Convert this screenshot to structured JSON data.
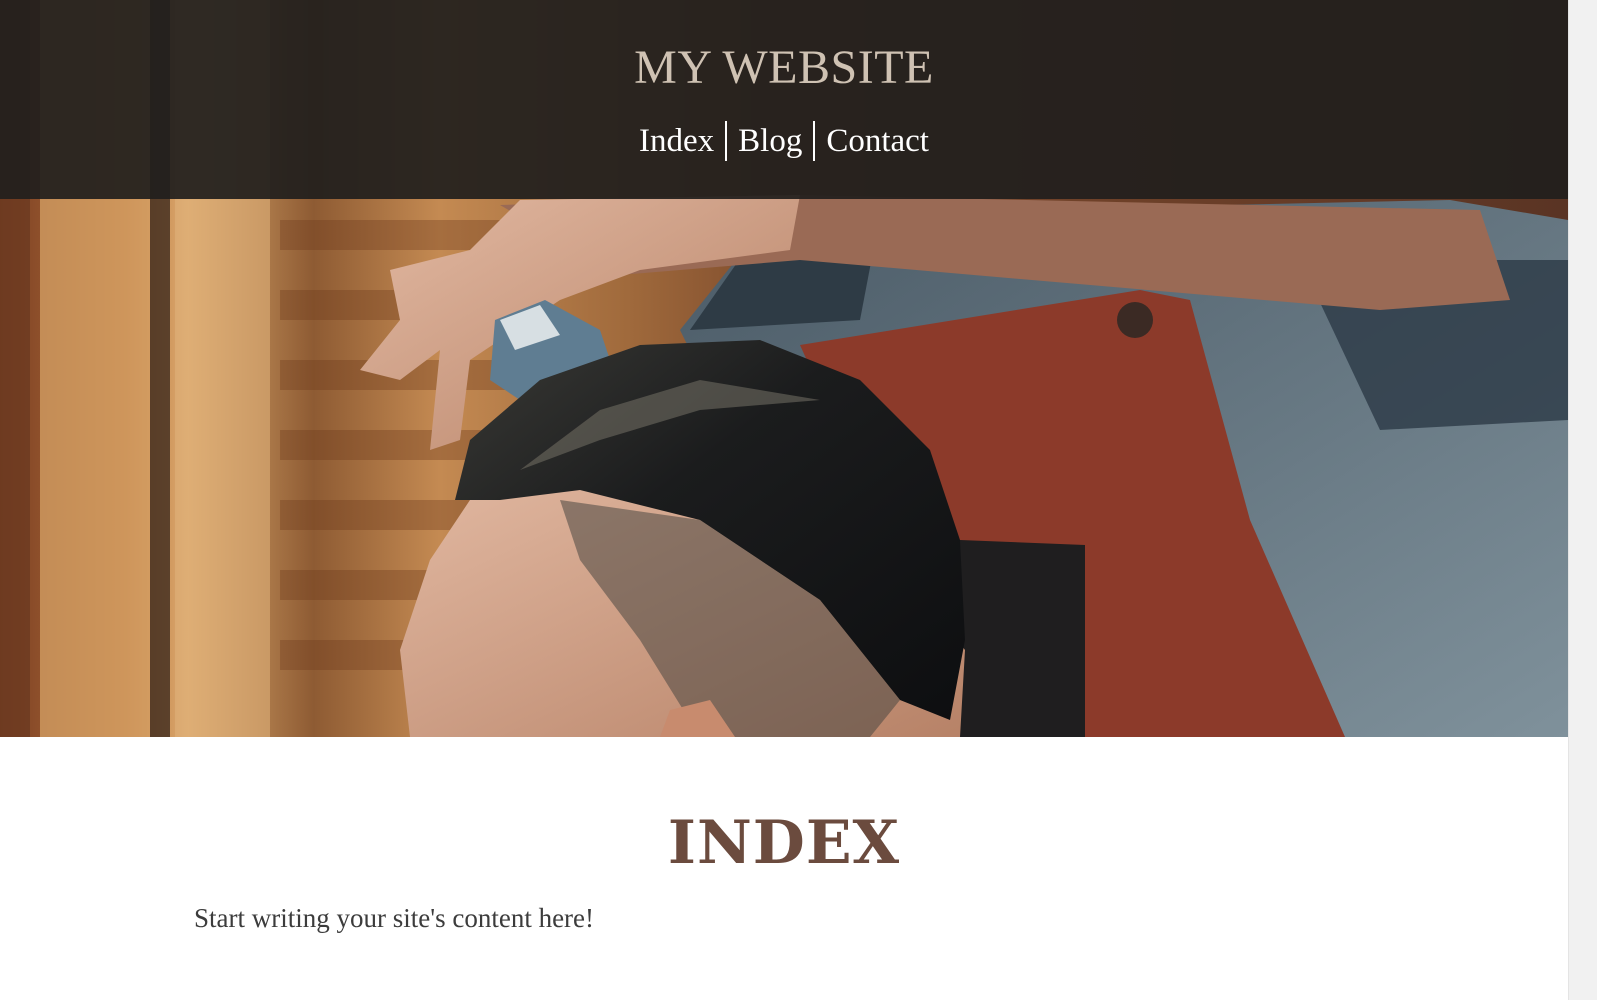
{
  "site": {
    "title": "MY WEBSITE"
  },
  "nav": {
    "items": [
      {
        "label": "Index"
      },
      {
        "label": "Blog"
      },
      {
        "label": "Contact"
      }
    ]
  },
  "main": {
    "heading": "INDEX",
    "body": "Start writing your site's content here!"
  },
  "colors": {
    "header_overlay": "#211f1d",
    "site_title": "#cfc2b3",
    "nav_text": "#ffffff",
    "heading": "#6b4b3e",
    "body_text": "#3c3c3c"
  }
}
